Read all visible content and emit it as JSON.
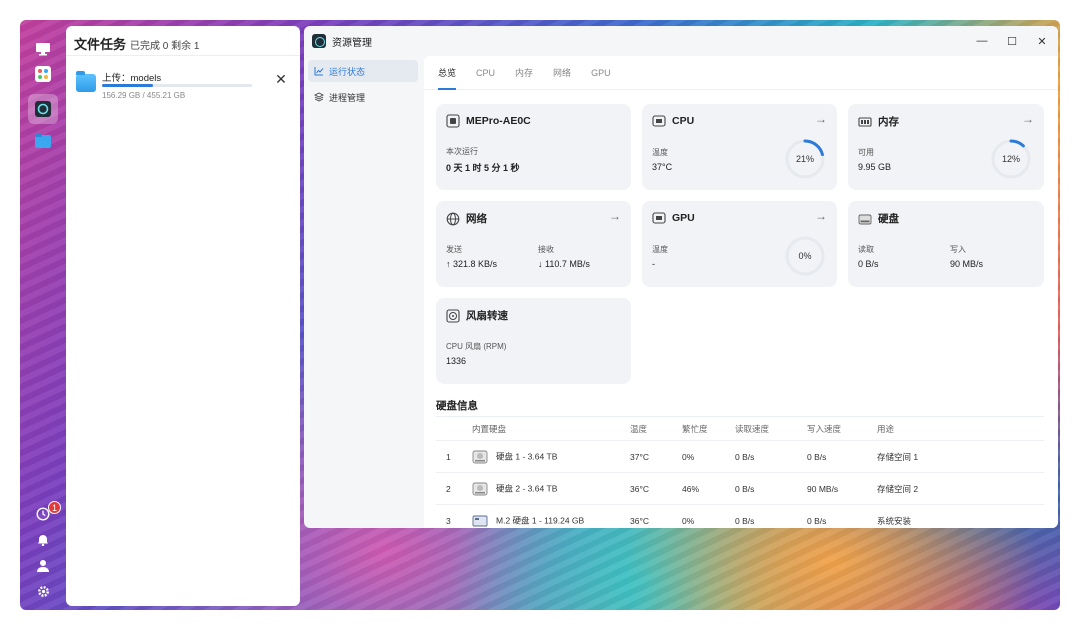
{
  "dock": {
    "items": [
      {
        "icon": "monitor-icon"
      },
      {
        "icon": "app-grid-icon"
      },
      {
        "icon": "resource-monitor-icon"
      },
      {
        "icon": "file-manager-icon"
      }
    ],
    "bottom": [
      {
        "icon": "task-clock-icon"
      },
      {
        "icon": "bell-icon"
      },
      {
        "icon": "user-icon"
      },
      {
        "icon": "settings-gear-icon"
      }
    ],
    "badge_count": "1"
  },
  "tasks": {
    "title": "文件任务",
    "subtitle": "已完成 0 剩余 1",
    "items": [
      {
        "name": "上传：models",
        "size": "156.29 GB / 455.21 GB",
        "progress": 0.343
      }
    ]
  },
  "window": {
    "title": "资源管理",
    "nav": [
      {
        "label": "运行状态",
        "icon": "chart-line-icon"
      },
      {
        "label": "进程管理",
        "icon": "layers-icon"
      }
    ],
    "tabs": [
      "总览",
      "CPU",
      "内存",
      "网络",
      "GPU"
    ],
    "active_tab": "总览"
  },
  "cards": {
    "device": {
      "title": "MEPro-AE0C",
      "label": "本次运行",
      "value": "0 天 1 时 5 分 1 秒"
    },
    "cpu": {
      "title": "CPU",
      "label": "温度",
      "value": "37°C",
      "percent_text": "21%",
      "percent": 21
    },
    "memory": {
      "title": "内存",
      "label": "可用",
      "value": "9.95 GB",
      "percent_text": "12%",
      "percent": 12
    },
    "network": {
      "title": "网络",
      "send_label": "发送",
      "send_value": "↑ 321.8 KB/s",
      "recv_label": "接收",
      "recv_value": "↓ 110.7 MB/s"
    },
    "gpu": {
      "title": "GPU",
      "label": "温度",
      "value": "-",
      "percent_text": "0%",
      "percent": 0
    },
    "disk": {
      "title": "硬盘",
      "read_label": "读取",
      "read_value": "0 B/s",
      "write_label": "写入",
      "write_value": "90 MB/s"
    },
    "fan": {
      "title": "风扇转速",
      "label": "CPU 风扇 (RPM)",
      "value": "1336"
    }
  },
  "disk_info": {
    "title": "硬盘信息",
    "columns": [
      "",
      "内置硬盘",
      "温度",
      "繁忙度",
      "读取速度",
      "写入速度",
      "用途"
    ],
    "rows": [
      {
        "index": "1",
        "name": "硬盘 1 - 3.64 TB",
        "temp": "37°C",
        "busy": "0%",
        "read": "0 B/s",
        "write": "0 B/s",
        "usage": "存储空间 1"
      },
      {
        "index": "2",
        "name": "硬盘 2 - 3.64 TB",
        "temp": "36°C",
        "busy": "46%",
        "read": "0 B/s",
        "write": "90 MB/s",
        "usage": "存储空间 2"
      },
      {
        "index": "3",
        "name": "M.2 硬盘 1 - 119.24 GB",
        "temp": "36°C",
        "busy": "0%",
        "read": "0 B/s",
        "write": "0 B/s",
        "usage": "系统安装"
      }
    ]
  },
  "colors": {
    "accent": "#2d7bd8",
    "ring_track": "#e6e9ee",
    "badge": "#e23a3a"
  }
}
